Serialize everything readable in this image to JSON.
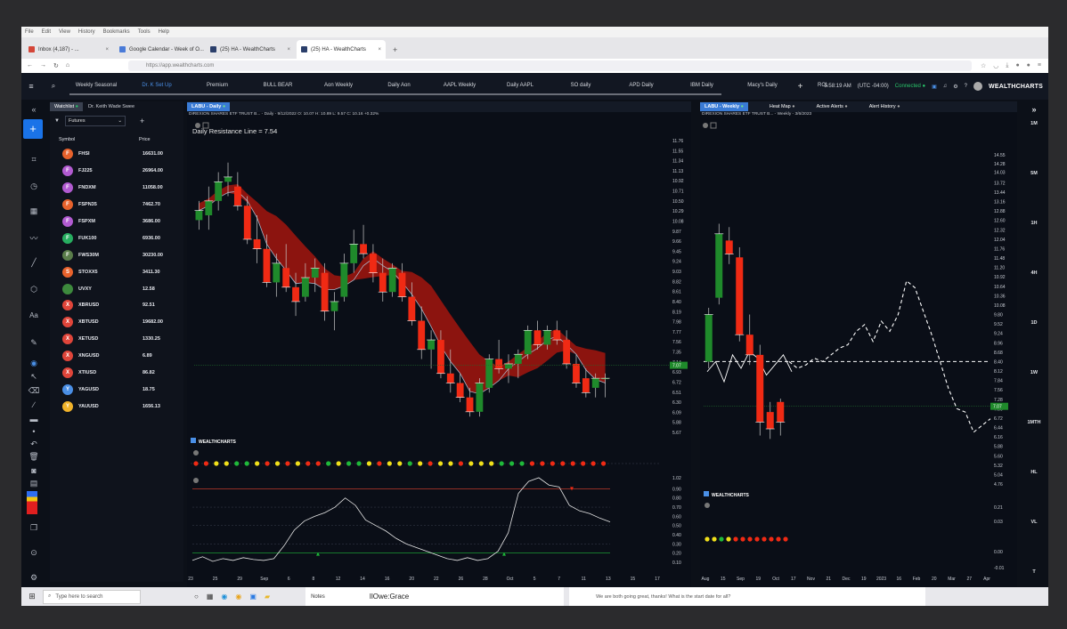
{
  "browser": {
    "menu": [
      "File",
      "Edit",
      "View",
      "History",
      "Bookmarks",
      "Tools",
      "Help"
    ],
    "tabs": [
      {
        "label": "Inbox (4,187) - ..."
      },
      {
        "label": "Google Calendar - Week of O..."
      },
      {
        "label": "(25) HA - WealthCharts"
      },
      {
        "label": "(25) HA - WealthCharts"
      }
    ],
    "url": "https://app.wealthcharts.com"
  },
  "appbar": {
    "tabs": [
      "Weekly Seasonal",
      "Dr. K Set Up",
      "Premium",
      "BULL BEAR",
      "Aon Weekly",
      "Daily Aon",
      "AAPL Weekly",
      "Daily AAPL",
      "SO daily",
      "APD Daily",
      "IBM Daily",
      "Macy's Daily",
      "RCL"
    ],
    "active_tab": "Dr. K Set Up",
    "time": "5:58:19 AM",
    "timezone": "(UTC -04:00)",
    "status": "Connected",
    "logo": "WEALTHCHARTS"
  },
  "watchlist": {
    "tab_active": "Watchlist",
    "tab_other": "Dr. Keith Wade Swee",
    "filter": "Futures",
    "col_symbol": "Symbol",
    "col_price": "Price",
    "rows": [
      {
        "letter": "F",
        "color": "#e8622c",
        "symbol": "FHSI",
        "price": "16631.00"
      },
      {
        "letter": "F",
        "color": "#b25bd1",
        "symbol": "FJ225",
        "price": "26964.00"
      },
      {
        "letter": "F",
        "color": "#b25bd1",
        "symbol": "FNDXM",
        "price": "11058.00"
      },
      {
        "letter": "F",
        "color": "#e8622c",
        "symbol": "FSPN35",
        "price": "7462.70"
      },
      {
        "letter": "F",
        "color": "#b25bd1",
        "symbol": "FSPXM",
        "price": "3686.00"
      },
      {
        "letter": "F",
        "color": "#27ae60",
        "symbol": "FUK100",
        "price": "6936.00"
      },
      {
        "letter": "F",
        "color": "#5a7d4a",
        "symbol": "FWS30M",
        "price": "30230.00"
      },
      {
        "letter": "S",
        "color": "#e8622c",
        "symbol": "STOXX5",
        "price": "3411.30"
      },
      {
        "letter": "",
        "color": "#3d8a3d",
        "symbol": "UVXY",
        "price": "12.58"
      },
      {
        "letter": "X",
        "color": "#e0453a",
        "symbol": "XBRUSD",
        "price": "92.51"
      },
      {
        "letter": "X",
        "color": "#e0453a",
        "symbol": "XBTUSD",
        "price": "19682.00"
      },
      {
        "letter": "X",
        "color": "#e0453a",
        "symbol": "XETUSD",
        "price": "1330.25"
      },
      {
        "letter": "X",
        "color": "#e0453a",
        "symbol": "XNGUSD",
        "price": "6.89"
      },
      {
        "letter": "X",
        "color": "#e0453a",
        "symbol": "XTIUSD",
        "price": "86.82"
      },
      {
        "letter": "Y",
        "color": "#4a8fe6",
        "symbol": "YAGUSD",
        "price": "18.75"
      },
      {
        "letter": "Y",
        "color": "#f1b32a",
        "symbol": "YAUUSD",
        "price": "1656.13"
      }
    ]
  },
  "daily_panel": {
    "chip": "LABU - Daily",
    "subtitle": "DIREXION SHARES ETF TRUST B... - Daily - 9/12/2022 O: 10.07 H: 10.89 L: 9.57 C: 10.16 +0.32%",
    "annotation": "Daily Resistance Line = 7.54",
    "last_price": "7.07",
    "logo": "WEALTHCHARTS"
  },
  "weekly_panel": {
    "chip": "LABU - Weekly",
    "tabs": [
      "Heat Map",
      "Active Alerts",
      "Alert History"
    ],
    "subtitle": "DIREXION SHARES ETF TRUST B... - Weekly - 3/6/2023",
    "last_price": "7.07",
    "logo": "WEALTHCHARTS"
  },
  "timeframes": [
    "1M",
    "5M",
    "1H",
    "4H",
    "1D",
    "1W",
    "1MTH",
    "HL",
    "VL",
    "T"
  ],
  "taskbar": {
    "search": "Type here to search",
    "notes": "Notes",
    "contact": "IlOwe:Grace",
    "message": "We are both going great, thanks! What is the start date for all?"
  },
  "chart_data": [
    {
      "type": "candlestick",
      "title": "LABU - Daily",
      "x_ticks": [
        "23",
        "25",
        "29",
        "Sep",
        "6",
        "8",
        "12",
        "14",
        "16",
        "20",
        "22",
        "26",
        "28",
        "Oct",
        "5",
        "7",
        "11",
        "13",
        "15",
        "17"
      ],
      "y_ticks": [
        "11.76",
        "11.55",
        "11.34",
        "11.13",
        "10.92",
        "10.71",
        "10.50",
        "10.29",
        "10.08",
        "9.87",
        "9.66",
        "9.45",
        "9.24",
        "9.03",
        "8.82",
        "8.61",
        "8.40",
        "8.19",
        "7.98",
        "7.77",
        "7.56",
        "7.35",
        "7.14",
        "6.93",
        "6.72",
        "6.51",
        "6.30",
        "6.09",
        "5.88",
        "5.67"
      ],
      "candles": [
        [
          10.1,
          10.5,
          9.9,
          10.3
        ],
        [
          10.2,
          10.8,
          9.9,
          10.5
        ],
        [
          10.5,
          11.1,
          10.3,
          10.9
        ],
        [
          10.9,
          11.3,
          10.6,
          11.0
        ],
        [
          10.8,
          11.1,
          10.3,
          10.4
        ],
        [
          10.4,
          10.6,
          9.6,
          9.7
        ],
        [
          9.7,
          10.2,
          9.2,
          9.5
        ],
        [
          9.5,
          9.8,
          8.7,
          8.8
        ],
        [
          8.8,
          9.4,
          8.5,
          9.2
        ],
        [
          9.1,
          9.6,
          8.6,
          8.7
        ],
        [
          8.7,
          9.0,
          8.1,
          8.4
        ],
        [
          8.5,
          9.2,
          8.4,
          8.9
        ],
        [
          8.9,
          9.3,
          8.6,
          9.1
        ],
        [
          9.0,
          9.2,
          8.0,
          8.2
        ],
        [
          8.2,
          8.6,
          7.8,
          8.4
        ],
        [
          8.5,
          9.4,
          8.4,
          9.2
        ],
        [
          9.2,
          9.9,
          9.0,
          9.6
        ],
        [
          9.6,
          10.0,
          9.3,
          9.4
        ],
        [
          9.4,
          9.6,
          8.8,
          9.0
        ],
        [
          9.0,
          9.3,
          8.4,
          8.6
        ],
        [
          8.6,
          9.2,
          8.5,
          9.1
        ],
        [
          9.0,
          9.2,
          8.4,
          8.5
        ],
        [
          8.5,
          8.8,
          7.9,
          8.0
        ],
        [
          8.0,
          8.3,
          7.2,
          7.4
        ],
        [
          7.4,
          7.8,
          7.0,
          7.6
        ],
        [
          7.6,
          7.8,
          6.8,
          6.9
        ],
        [
          6.9,
          7.4,
          6.5,
          6.7
        ],
        [
          6.7,
          6.9,
          6.3,
          6.4
        ],
        [
          6.4,
          6.6,
          6.0,
          6.1
        ],
        [
          6.1,
          6.8,
          6.0,
          6.7
        ],
        [
          6.6,
          7.3,
          6.5,
          7.2
        ],
        [
          7.2,
          7.6,
          6.9,
          7.0
        ],
        [
          7.0,
          7.3,
          6.7,
          7.1
        ],
        [
          7.1,
          7.4,
          6.8,
          7.3
        ],
        [
          7.3,
          7.9,
          7.2,
          7.8
        ],
        [
          7.8,
          8.0,
          7.4,
          7.5
        ],
        [
          7.5,
          7.9,
          7.4,
          7.8
        ],
        [
          7.8,
          8.0,
          7.5,
          7.6
        ],
        [
          7.6,
          7.8,
          7.0,
          7.1
        ],
        [
          7.1,
          7.3,
          6.6,
          6.7
        ],
        [
          6.8,
          7.0,
          6.4,
          6.5
        ],
        [
          6.6,
          6.9,
          6.4,
          6.8
        ],
        [
          6.8,
          6.9,
          6.4,
          6.8
        ]
      ],
      "dots": [
        "red",
        "red",
        "yellow",
        "yellow",
        "green",
        "green",
        "yellow",
        "red",
        "yellow",
        "red",
        "yellow",
        "red",
        "red",
        "green",
        "yellow",
        "green",
        "green",
        "yellow",
        "red",
        "yellow",
        "yellow",
        "green",
        "yellow",
        "red",
        "yellow",
        "yellow",
        "red",
        "yellow",
        "yellow",
        "yellow",
        "green",
        "green",
        "green",
        "red",
        "red",
        "red",
        "red",
        "red",
        "red",
        "red",
        "red"
      ],
      "oscillator_ticks": [
        "1.02",
        "0.90",
        "0.80",
        "0.70",
        "0.60",
        "0.50",
        "0.40",
        "0.30",
        "0.20",
        "0.10"
      ],
      "oscillator": [
        0.12,
        0.16,
        0.11,
        0.14,
        0.12,
        0.15,
        0.13,
        0.12,
        0.14,
        0.28,
        0.45,
        0.55,
        0.6,
        0.64,
        0.7,
        0.8,
        0.72,
        0.56,
        0.5,
        0.44,
        0.36,
        0.3,
        0.26,
        0.22,
        0.18,
        0.14,
        0.12,
        0.15,
        0.12,
        0.14,
        0.22,
        0.42,
        0.85,
        0.98,
        1.02,
        0.94,
        0.92,
        0.72,
        0.66,
        0.63,
        0.58,
        0.54
      ]
    },
    {
      "type": "candlestick",
      "title": "LABU - Weekly",
      "x_ticks": [
        "Aug",
        "15",
        "Sep",
        "19",
        "Oct",
        "17",
        "Nov",
        "21",
        "Dec",
        "19",
        "2023",
        "16",
        "Feb",
        "20",
        "Mar",
        "27",
        "Apr"
      ],
      "y_ticks": [
        "14.55",
        "14.28",
        "14.03",
        "13.72",
        "13.44",
        "13.16",
        "12.88",
        "12.60",
        "12.32",
        "12.04",
        "11.76",
        "11.48",
        "11.20",
        "10.92",
        "10.64",
        "10.36",
        "10.08",
        "9.80",
        "9.52",
        "9.24",
        "8.96",
        "8.68",
        "8.40",
        "8.12",
        "7.84",
        "7.56",
        "7.28",
        "7.00",
        "6.72",
        "6.44",
        "6.16",
        "5.88",
        "5.60",
        "5.32",
        "5.04",
        "4.76"
      ],
      "candles": [
        [
          8.4,
          10.0,
          8.2,
          9.8
        ],
        [
          10.3,
          12.5,
          10.1,
          12.2
        ],
        [
          12.0,
          12.4,
          11.3,
          11.6
        ],
        [
          11.5,
          11.8,
          9.0,
          9.2
        ],
        [
          9.2,
          9.8,
          8.3,
          8.6
        ],
        [
          8.6,
          8.9,
          6.2,
          6.6
        ],
        [
          6.9,
          7.2,
          6.1,
          6.4
        ],
        [
          7.2,
          7.3,
          6.2,
          6.6
        ]
      ],
      "dots": [
        "yellow",
        "yellow",
        "green",
        "yellow",
        "red",
        "red",
        "red",
        "red",
        "red",
        "red",
        "red",
        "red"
      ],
      "dashed_projection": [
        8.4,
        8.2,
        8.3,
        8.5,
        8.4,
        8.6,
        8.8,
        8.9,
        9.3,
        9.5,
        9.0,
        9.6,
        9.3,
        9.8,
        10.8,
        10.6,
        9.9,
        9.2,
        8.4,
        7.6,
        7.0,
        6.9,
        6.3,
        6.5,
        6.7
      ],
      "dashed_level": 8.4,
      "solid_line": [
        8.1,
        8.4,
        7.8,
        8.6,
        8.2,
        8.7,
        8.5,
        8.0,
        8.3,
        8.6,
        8.1
      ]
    }
  ]
}
